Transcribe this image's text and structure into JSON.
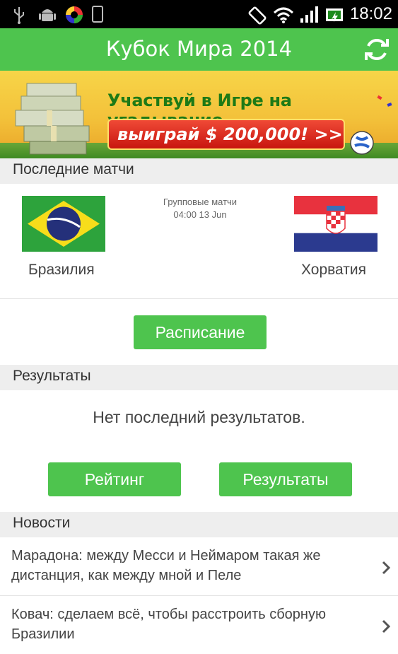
{
  "status_bar": {
    "time": "18:02",
    "icons": [
      "usb-icon",
      "android-icon",
      "app-icon",
      "phone-icon",
      "rotate-icon",
      "wifi-icon",
      "signal-icon",
      "battery-icon"
    ]
  },
  "app_bar": {
    "title": "Кубок Мира 2014",
    "refresh_icon": "refresh-icon",
    "accent": "#4ec44e"
  },
  "banner": {
    "line1": "Участвуй в Игре на угадывание",
    "line2": "выиграй $ 200,000! >>"
  },
  "recent_matches": {
    "header": "Последние матчи",
    "stage": "Групповые матчи",
    "datetime": "04:00 13 Jun",
    "home_team": "Бразилия",
    "away_team": "Хорватия"
  },
  "schedule_button": "Расписание",
  "results": {
    "header": "Результаты",
    "empty_text": "Нет последний результатов.",
    "rating_button": "Рейтинг",
    "results_button": "Результаты"
  },
  "news": {
    "header": "Новости",
    "items": [
      {
        "text": "Марадона: между Месси и Неймаром такая же дистанция, как между мной и Пеле"
      },
      {
        "text": "Ковач: сделаем всё, чтобы расстроить сборную Бразилии"
      }
    ]
  }
}
